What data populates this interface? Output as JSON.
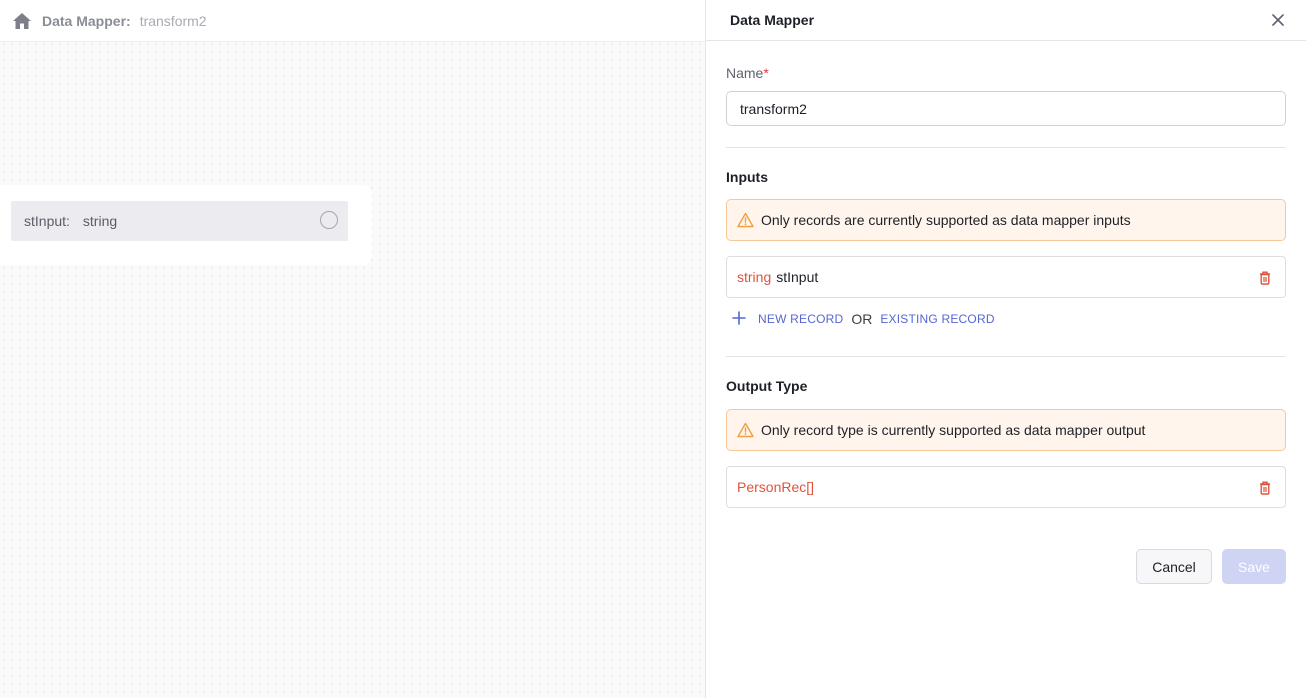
{
  "breadcrumb": {
    "title": "Data Mapper:",
    "value": "transform2",
    "home_icon": "home-icon"
  },
  "canvas_node": {
    "param_name": "stInput:",
    "param_type": "string"
  },
  "panel": {
    "title": "Data Mapper",
    "close_icon": "close-icon",
    "name_label": "Name",
    "name_required_mark": "*",
    "name_value": "transform2",
    "inputs_title": "Inputs",
    "inputs_warning": "Only records are currently supported as data mapper inputs",
    "input_item": {
      "type": "string",
      "name": "stInput"
    },
    "new_record_label": "NEW RECORD",
    "or_label": "OR",
    "existing_record_label": "EXISTING RECORD",
    "output_title": "Output Type",
    "output_warning": "Only record type is currently supported as data mapper output",
    "output_item": {
      "type": "PersonRec[]"
    },
    "cancel_label": "Cancel",
    "save_label": "Save"
  },
  "colors": {
    "accent": "#5567d5",
    "type_keyword": "#e0533b",
    "warning_bg": "#fff5ec",
    "warning_border": "#f5c89a",
    "save_disabled": "#cfd3f4"
  }
}
